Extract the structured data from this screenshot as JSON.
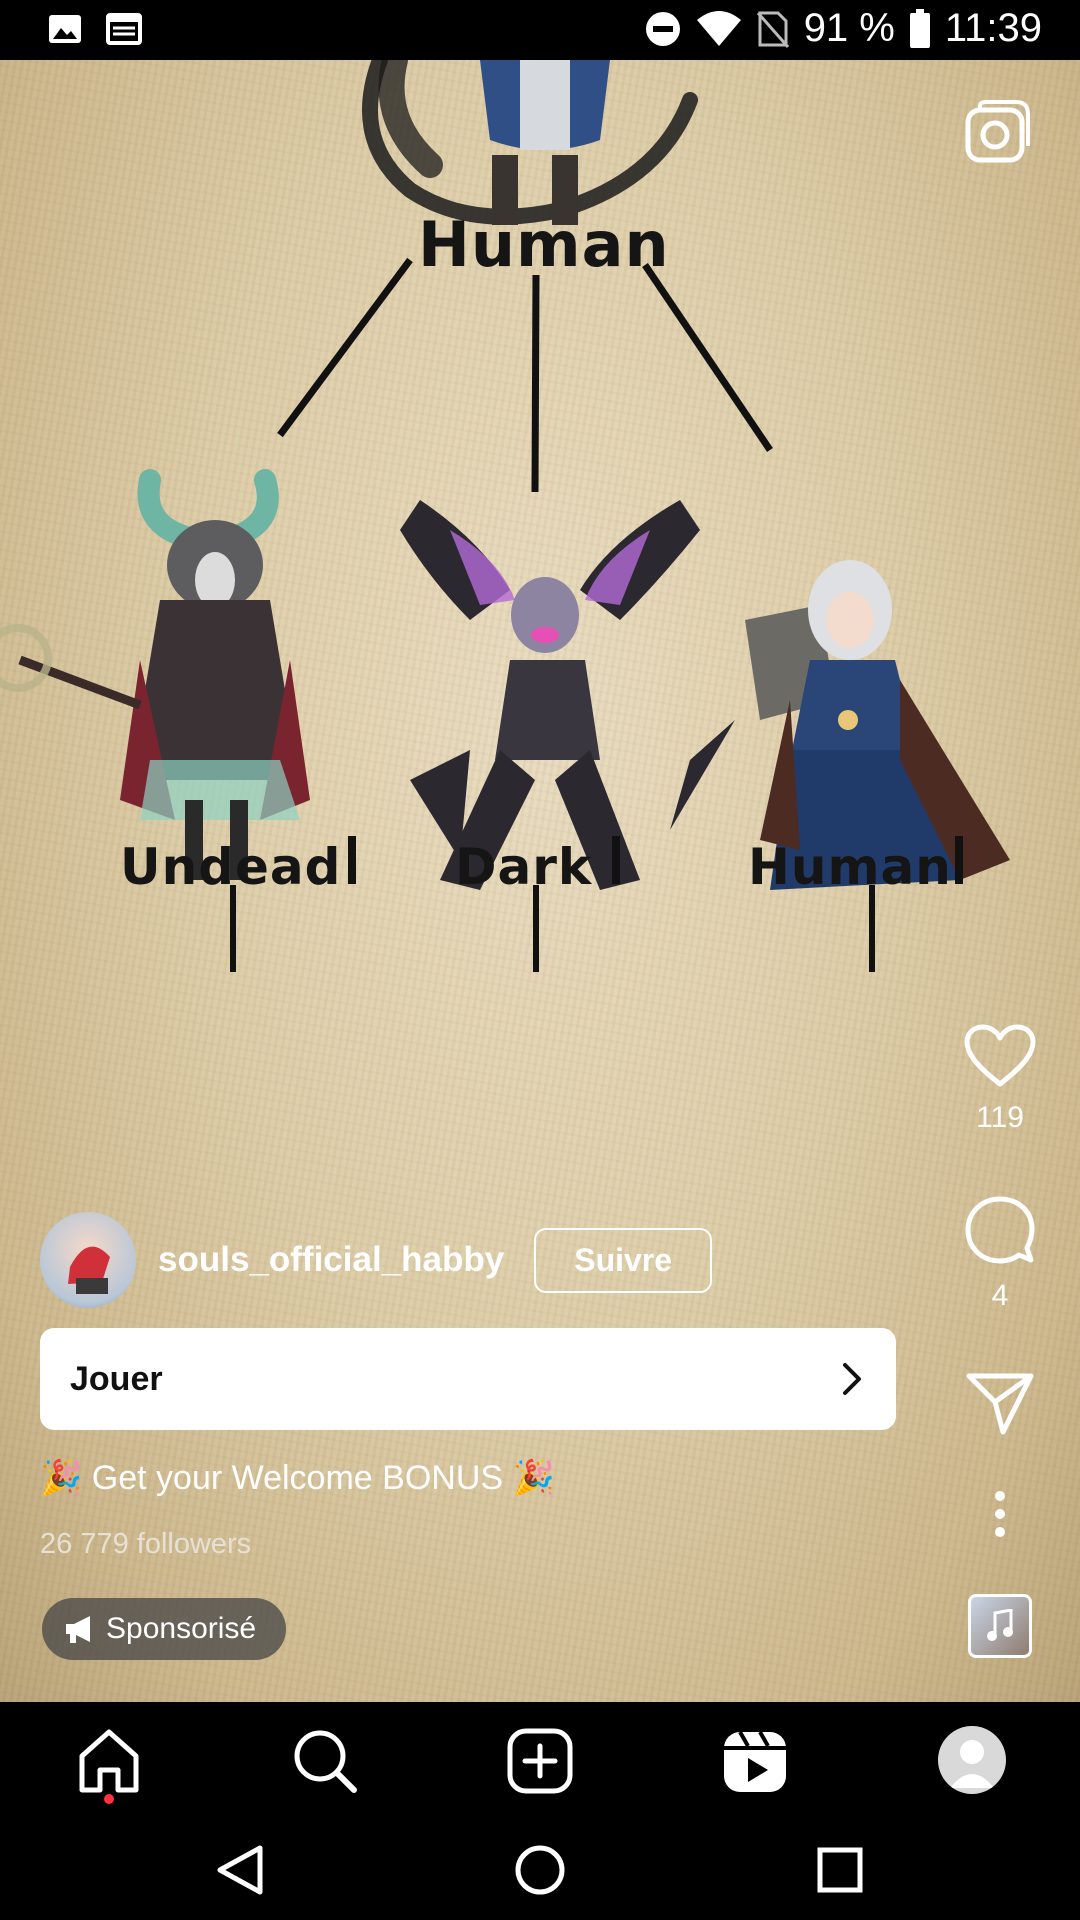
{
  "status_bar": {
    "battery": "91 %",
    "time": "11:39",
    "icons": [
      "image-icon",
      "news-icon",
      "dnd-icon",
      "wifi-icon",
      "no-sim-icon",
      "battery-icon"
    ]
  },
  "video": {
    "labels": {
      "top": "Human",
      "left": "Undead",
      "middle": "Dark",
      "right": "Human"
    }
  },
  "actions": {
    "likes": "119",
    "comments": "4"
  },
  "post": {
    "username": "souls_official_habby",
    "follow_label": "Suivre",
    "cta_label": "Jouer",
    "caption": "🎉 Get your Welcome BONUS 🎉",
    "followers": "26 779 followers",
    "sponsored": "Sponsorisé"
  },
  "colors": {
    "background": "#000000",
    "parchment": "#ddcda8",
    "accent_dot": "#ff3040"
  }
}
